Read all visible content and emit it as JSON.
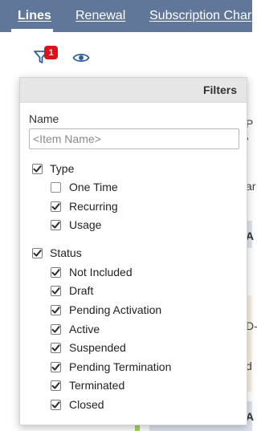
{
  "tabs": [
    {
      "label": "Lines",
      "active": true
    },
    {
      "label": "Renewal",
      "active": false
    },
    {
      "label": "Subscription Char",
      "active": false
    }
  ],
  "toolbar": {
    "filter_badge": "1",
    "filter_icon": "filter-icon",
    "eye_icon": "eye-icon"
  },
  "background_fragments": [
    "P",
    "'",
    "ar",
    "A",
    "D-",
    "d",
    "A"
  ],
  "filters": {
    "title": "Filters",
    "name": {
      "label": "Name",
      "placeholder": "<Item Name>",
      "value": ""
    },
    "type": {
      "label": "Type",
      "checked": true,
      "options": [
        {
          "label": "One Time",
          "checked": false
        },
        {
          "label": "Recurring",
          "checked": true
        },
        {
          "label": "Usage",
          "checked": true
        }
      ]
    },
    "status": {
      "label": "Status",
      "checked": true,
      "options": [
        {
          "label": "Not Included",
          "checked": true
        },
        {
          "label": "Draft",
          "checked": true
        },
        {
          "label": "Pending Activation",
          "checked": true
        },
        {
          "label": "Active",
          "checked": true
        },
        {
          "label": "Suspended",
          "checked": true
        },
        {
          "label": "Pending Termination",
          "checked": true
        },
        {
          "label": "Terminated",
          "checked": true
        },
        {
          "label": "Closed",
          "checked": true
        }
      ]
    }
  },
  "colors": {
    "tabbar": "#607799",
    "badge": "#e0101b",
    "icon": "#2f5f9e"
  }
}
